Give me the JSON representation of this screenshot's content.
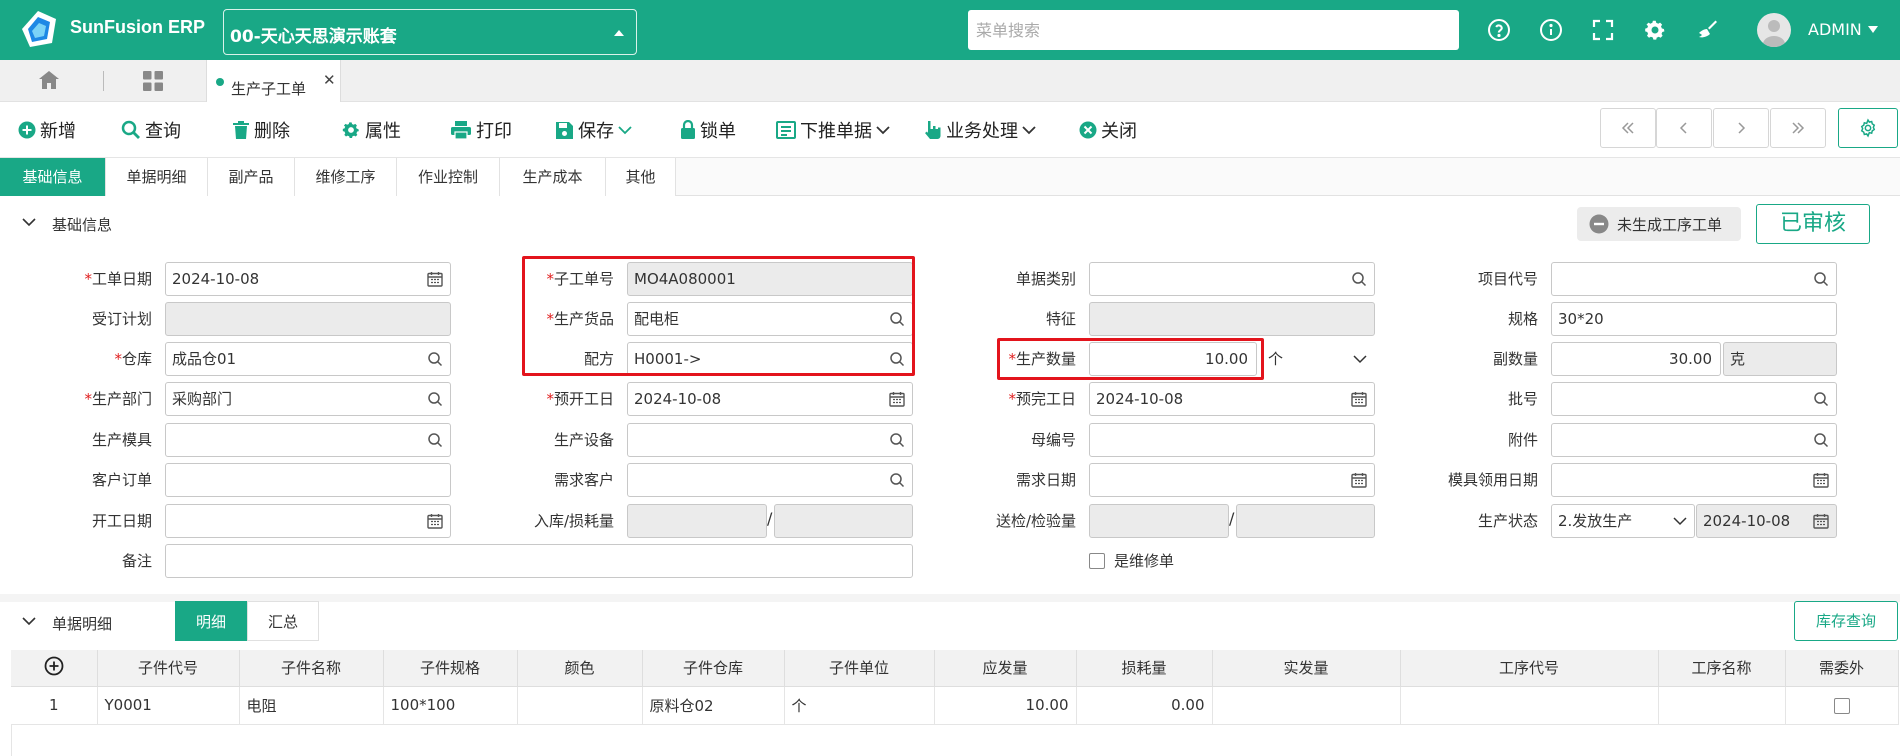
{
  "app": {
    "brand": "SunFusion ERP",
    "account": "00-天心天思演示账套",
    "search_placeholder": "菜单搜索",
    "user": "ADMIN"
  },
  "colors": {
    "primary": "#19a886",
    "required": "#e02020",
    "highlight": "#e3141c"
  },
  "tabstrip": {
    "doc_tab": "生产子工单",
    "close": "✕"
  },
  "toolbar": {
    "new": "新增",
    "query": "查询",
    "delete": "删除",
    "properties": "属性",
    "print": "打印",
    "save": "保存",
    "lock": "锁单",
    "push_down": "下推单据",
    "business": "业务处理",
    "close": "关闭"
  },
  "section_tabs": [
    "基础信息",
    "单据明细",
    "副产品",
    "维修工序",
    "作业控制",
    "生产成本",
    "其他"
  ],
  "basic": {
    "title": "基础信息",
    "status_chip": "未生成工序工单",
    "approved": "已审核",
    "labels": {
      "work_date": "工单日期",
      "order_plan": "受订计划",
      "warehouse": "仓库",
      "prod_dept": "生产部门",
      "prod_mold": "生产模具",
      "customer_order": "客户订单",
      "start_date": "开工日期",
      "remark": "备注",
      "sub_order_no": "子工单号",
      "prod_goods": "生产货品",
      "recipe": "配方",
      "plan_start": "预开工日",
      "prod_equipment": "生产设备",
      "demand_customer": "需求客户",
      "in_loss": "入库/损耗量",
      "doc_type": "单据类别",
      "feature": "特征",
      "prod_qty": "生产数量",
      "plan_finish": "预完工日",
      "parent_no": "母编号",
      "demand_date": "需求日期",
      "inspect_qty": "送检/检验量",
      "repair_order": "是维修单",
      "project_code": "项目代号",
      "spec": "规格",
      "sub_qty": "副数量",
      "batch_no": "批号",
      "attachment": "附件",
      "mold_use_date": "模具领用日期",
      "prod_status": "生产状态"
    },
    "values": {
      "work_date": "2024-10-08",
      "warehouse": "成品仓01",
      "prod_dept": "采购部门",
      "sub_order_no": "MO4A080001",
      "prod_goods": "配电柜",
      "recipe": "H0001->",
      "plan_start": "2024-10-08",
      "prod_qty": "10.00",
      "prod_unit": "个",
      "plan_finish": "2024-10-08",
      "spec": "30*20",
      "sub_qty": "30.00",
      "sub_unit": "克",
      "prod_status": "2.发放生产",
      "prod_status_date": "2024-10-08",
      "slash": "/"
    }
  },
  "detail": {
    "title": "单据明细",
    "tabs": [
      "明细",
      "汇总"
    ],
    "stock_query": "库存查询",
    "columns": [
      "子件代号",
      "子件名称",
      "子件规格",
      "颜色",
      "子件仓库",
      "子件单位",
      "应发量",
      "损耗量",
      "实发量",
      "工序代号",
      "工序名称",
      "需委外"
    ],
    "rows": [
      {
        "idx": "1",
        "code": "Y0001",
        "name": "电阻",
        "spec": "100*100",
        "color": "",
        "warehouse": "原料仓02",
        "unit": "个",
        "qty": "10.00",
        "loss": "0.00",
        "actual": "",
        "op_code": "",
        "op_name": ""
      }
    ]
  }
}
